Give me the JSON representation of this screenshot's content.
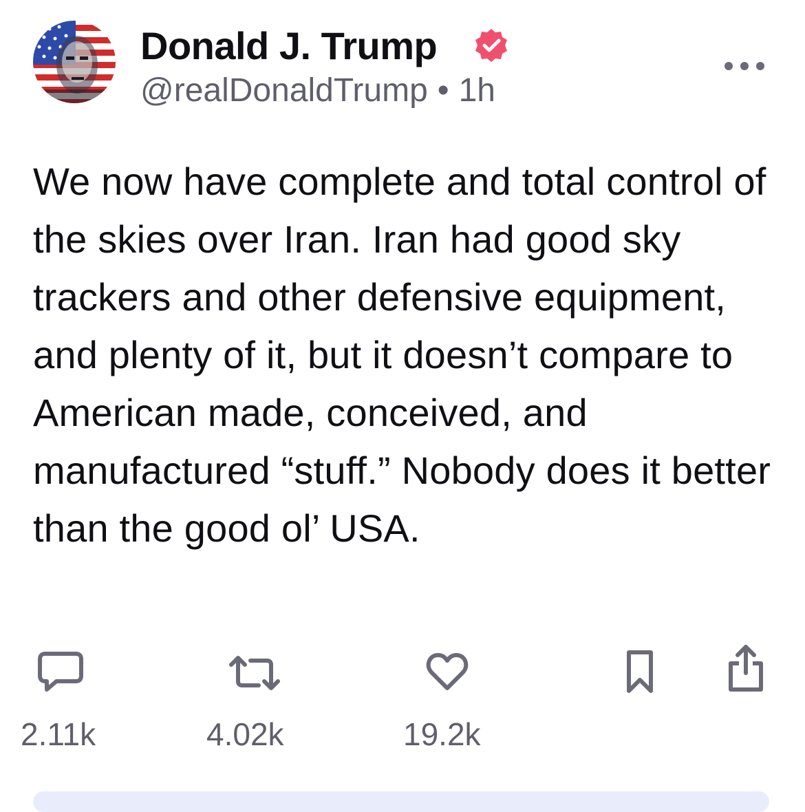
{
  "post": {
    "display_name": "Donald J. Trump",
    "handle": "@realDonaldTrump",
    "separator": "•",
    "time": "1h",
    "body": "We now have complete and total control of the skies over Iran. Iran had good sky trackers and other defensive equipment, and plenty of it, but it doesn’t compare to American made, conceived, and manufactured “stuff.” Nobody does it better than the good ol’ USA.",
    "verified_badge_color": "#f0506e"
  },
  "actions": {
    "reply_count": "2.11k",
    "repost_count": "4.02k",
    "like_count": "19.2k"
  },
  "icons": {
    "avatar": "flag-portrait-avatar",
    "verified": "verified-badge-icon",
    "more": "ellipsis-icon",
    "reply": "speech-bubble-icon",
    "repost": "repost-arrows-icon",
    "like": "heart-icon",
    "bookmark": "bookmark-icon",
    "share": "share-icon"
  }
}
